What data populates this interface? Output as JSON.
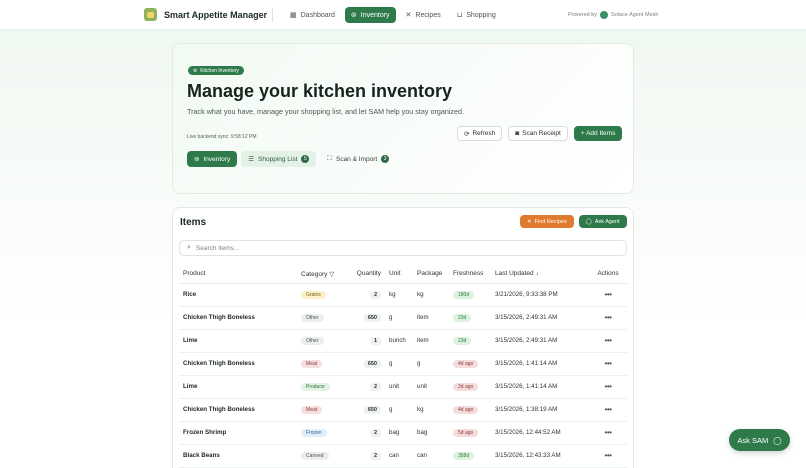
{
  "app": {
    "name": "Smart Appetite Manager",
    "powered_by": "Powered by",
    "powered_by_brand": "Solace Agent Mesh"
  },
  "nav": [
    {
      "label": "Dashboard",
      "icon": "grid-icon",
      "active": false
    },
    {
      "label": "Inventory",
      "icon": "box-icon",
      "active": true
    },
    {
      "label": "Recipes",
      "icon": "utensils-icon",
      "active": false
    },
    {
      "label": "Shopping",
      "icon": "cart-icon",
      "active": false
    }
  ],
  "hero": {
    "chip": "Kitchen Inventory",
    "title": "Manage your kitchen inventory",
    "description": "Track what you have, manage your shopping list, and let SAM help you stay organized.",
    "sync": "Live backend sync: 9:58:12 PM",
    "actions": {
      "refresh": "Refresh",
      "scan_receipt": "Scan Receipt",
      "add_items": "+ Add Items"
    },
    "tabs": [
      {
        "label": "Inventory",
        "count": ""
      },
      {
        "label": "Shopping List",
        "count": "5"
      },
      {
        "label": "Scan & Import",
        "count": "3"
      }
    ]
  },
  "items": {
    "title": "Items",
    "find_recipes": "Find Recipes",
    "ask_agent": "Ask Agent",
    "search_placeholder": "Search items...",
    "columns": {
      "product": "Product",
      "category": "Category",
      "quantity": "Quantity",
      "unit": "Unit",
      "package": "Package",
      "freshness": "Freshness",
      "last_updated": "Last Updated ↓",
      "actions": "Actions"
    },
    "rows": [
      {
        "product": "Rice",
        "category": "Grains",
        "quantity": "2",
        "unit": "kg",
        "package": "kg",
        "freshness": "180d",
        "last_updated": "3/21/2026, 9:33:38 PM"
      },
      {
        "product": "Chicken Thigh Boneless",
        "category": "Other",
        "quantity": "650",
        "unit": "g",
        "package": "item",
        "freshness": "23d",
        "last_updated": "3/15/2026, 2:49:31 AM"
      },
      {
        "product": "Lime",
        "category": "Other",
        "quantity": "1",
        "unit": "bunch",
        "package": "item",
        "freshness": "23d",
        "last_updated": "3/15/2026, 2:49:31 AM"
      },
      {
        "product": "Chicken Thigh Boneless",
        "category": "Meat",
        "quantity": "650",
        "unit": "g",
        "package": "g",
        "freshness": "4d ago",
        "last_updated": "3/15/2026, 1:41:14 AM"
      },
      {
        "product": "Lime",
        "category": "Produce",
        "quantity": "2",
        "unit": "unit",
        "package": "unit",
        "freshness": "2d ago",
        "last_updated": "3/15/2026, 1:41:14 AM"
      },
      {
        "product": "Chicken Thigh Boneless",
        "category": "Meat",
        "quantity": "650",
        "unit": "g",
        "package": "kg",
        "freshness": "4d ago",
        "last_updated": "3/15/2026, 1:38:19 AM"
      },
      {
        "product": "Frozen Shrimp",
        "category": "Frozen",
        "quantity": "2",
        "unit": "bag",
        "package": "bag",
        "freshness": "5d ago",
        "last_updated": "3/15/2026, 12:44:52 AM"
      },
      {
        "product": "Black Beans",
        "category": "Canned",
        "quantity": "2",
        "unit": "can",
        "package": "can",
        "freshness": "358d",
        "last_updated": "3/15/2026, 12:43:33 AM"
      }
    ]
  },
  "ask_sam": "Ask SAM",
  "colors": {
    "accent": "#2f7a4b",
    "orange": "#e07a2f"
  }
}
